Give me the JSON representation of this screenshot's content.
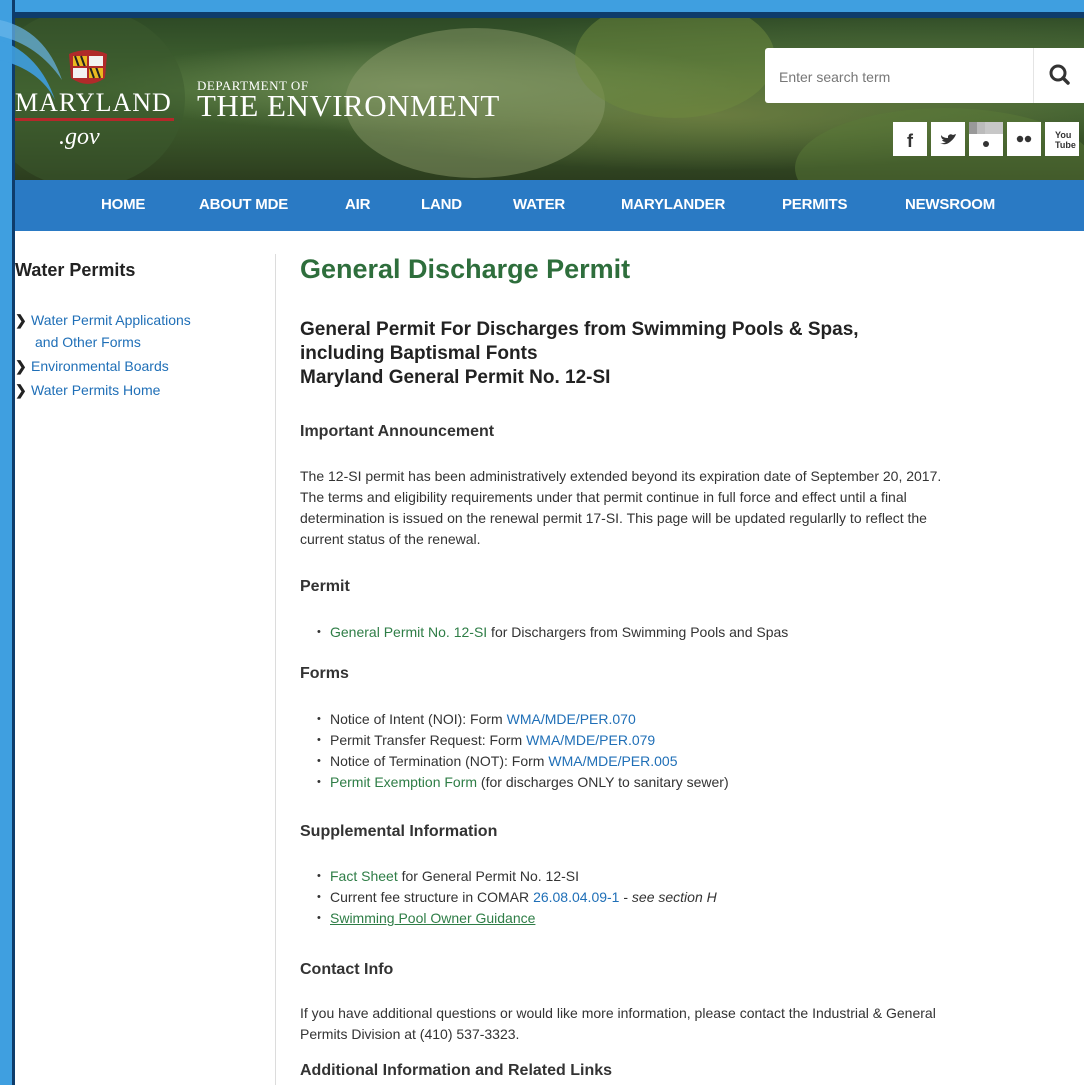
{
  "header": {
    "logo_word": "MARYLAND",
    "logo_gov": ".gov",
    "dept_small": "DEPARTMENT OF",
    "dept_big": "THE ENVIRONMENT",
    "search_placeholder": "Enter search term",
    "social_icons": [
      "facebook-icon",
      "twitter-icon",
      "instagram-icon",
      "flickr-icon",
      "youtube-icon"
    ]
  },
  "nav": {
    "items": [
      "HOME",
      "ABOUT MDE",
      "AIR",
      "LAND",
      "WATER",
      "MARYLANDER",
      "PERMITS",
      "NEWSROOM"
    ]
  },
  "sidebar": {
    "title": "Water Permits",
    "links": [
      "Water Permit Applications",
      "and Other Forms",
      "Environmental Boards",
      "Water Permits Home"
    ]
  },
  "main": {
    "title": "General Discharge Permit",
    "subtitle_lines": [
      "General Permit For Discharges from Swimming Pools & Spas,",
      "including Baptismal Fonts",
      "Maryland General Permit No. 12-SI"
    ],
    "announcement_heading": "Important Announcement",
    "announcement_lines": [
      "The 12-SI permit has been administratively extended beyond its expiration date of September 20, 2017.",
      "The terms and eligibility requirements under that permit continue in full force and effect until a final",
      "determination is issued on the renewal permit 17-SI.  This page will be updated regularlly to reflect the",
      "current status of the renewal."
    ],
    "permit_heading": "Permit",
    "permit_link": "General Permit No. 12-SI",
    "permit_rest": " for Dischargers from Swimming Pools and Spas",
    "forms_heading": "Forms",
    "forms": [
      {
        "prefix": "Notice of Intent (NOI):  Form ",
        "link": "WMA/MDE/PER.070",
        "suffix": ""
      },
      {
        "prefix": "Permit Transfer Request:  Form ",
        "link": "WMA/MDE/PER.079",
        "suffix": ""
      },
      {
        "prefix": "Notice of Termination (NOT):  Form ",
        "link": "WMA/MDE/PER.005",
        "suffix": ""
      },
      {
        "prefix": "",
        "link": "Permit Exemption Form",
        "suffix": " (for discharges ONLY to sanitary sewer)"
      }
    ],
    "supplemental_heading": "Supplemental Information",
    "supplemental": {
      "fact_link": "Fact Sheet",
      "fact_rest": " for General Permit No. 12-SI",
      "fee_prefix": "Current fee structure in COMAR ",
      "fee_link": "26.08.04.09-1",
      "fee_rest": " - ",
      "fee_italic": "see section H",
      "guidance_link": "Swimming Pool Owner Guidance"
    },
    "contact_heading": "Contact Info",
    "contact_lines": [
      "If you have additional questions or would like more information, please contact the Industrial & General",
      "Permits Division at (410) 537-3323."
    ],
    "additional_heading": "Additional Information and Related Links"
  },
  "colors": {
    "nav": "#2a7ac4",
    "title_green": "#2e6e3c",
    "link_blue": "#1f6fb7",
    "link_green": "#2e7d46",
    "frame": "#3f9fe0"
  }
}
